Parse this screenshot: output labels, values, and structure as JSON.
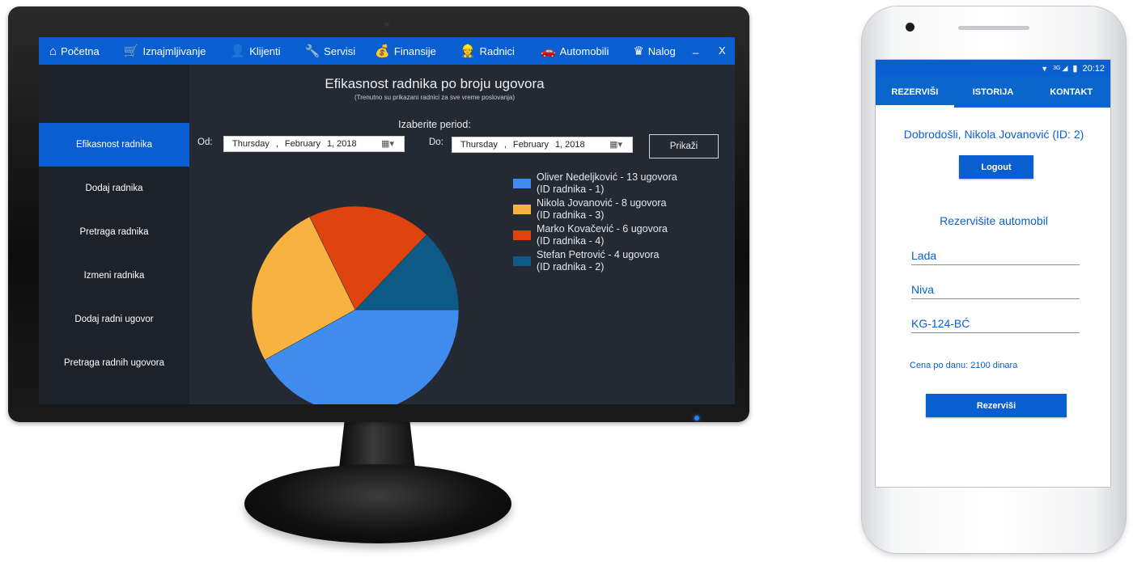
{
  "desktop": {
    "nav": [
      {
        "icon": "⌂",
        "label": "Početna"
      },
      {
        "icon": "🛒",
        "label": "Iznajmljivanje"
      },
      {
        "icon": "👤",
        "label": "Klijenti"
      },
      {
        "icon": "🔧",
        "label": "Servisi"
      },
      {
        "icon": "💰",
        "label": "Finansije"
      },
      {
        "icon": "👷",
        "label": "Radnici"
      },
      {
        "icon": "🚗",
        "label": "Automobili"
      },
      {
        "icon": "♛",
        "label": "Nalog"
      }
    ],
    "minimize": "_",
    "close": "X",
    "sidebar": [
      {
        "label": "Efikasnost radnika",
        "active": true
      },
      {
        "label": "Dodaj radnika",
        "active": false
      },
      {
        "label": "Pretraga radnika",
        "active": false
      },
      {
        "label": "Izmeni radnika",
        "active": false
      },
      {
        "label": "Dodaj radni ugovor",
        "active": false
      },
      {
        "label": "Pretraga radnih ugovora",
        "active": false
      }
    ],
    "title": "Efikasnost radnika po broju ugovora",
    "subtitle": "(Trenutno su prikazani radnici za sve vreme poslovanja)",
    "period_label": "Izaberite period:",
    "from_label": "Od:",
    "to_label": "Do:",
    "from_date": {
      "weekday": "Thursday",
      "sep": ",",
      "month": "February",
      "day_year": "1, 2018"
    },
    "to_date": {
      "weekday": "Thursday",
      "sep": ",",
      "month": "February",
      "day_year": "1, 2018"
    },
    "show_button": "Prikaži"
  },
  "chart_data": {
    "type": "pie",
    "slices": [
      {
        "label": "Oliver Nedeljković - 13 ugovora",
        "sub": "(ID radnika - 1)",
        "value": 13,
        "color": "#3f8cee"
      },
      {
        "label": "Nikola Jovanović - 8 ugovora",
        "sub": "(ID radnika - 3)",
        "value": 8,
        "color": "#f8b23f"
      },
      {
        "label": "Marko Kovačević - 6 ugovora",
        "sub": "(ID radnika - 4)",
        "value": 6,
        "color": "#e0440e"
      },
      {
        "label": "Stefan Petrović - 4 ugovora",
        "sub": "(ID radnika - 2)",
        "value": 4,
        "color": "#0d5a87"
      }
    ]
  },
  "mobile": {
    "time": "20:12",
    "network": "3G",
    "tabs": [
      {
        "label": "REZERVIŠI",
        "active": true
      },
      {
        "label": "ISTORIJA",
        "active": false
      },
      {
        "label": "KONTAKT",
        "active": false
      }
    ],
    "welcome": "Dobrodošli, Nikola Jovanović (ID: 2)",
    "logout": "Logout",
    "heading": "Rezervišite automobil",
    "fields": [
      "Lada",
      "Niva",
      "KG-124-BĆ"
    ],
    "price": "Cena po danu: 2100 dinara",
    "reserve": "Rezerviši"
  }
}
